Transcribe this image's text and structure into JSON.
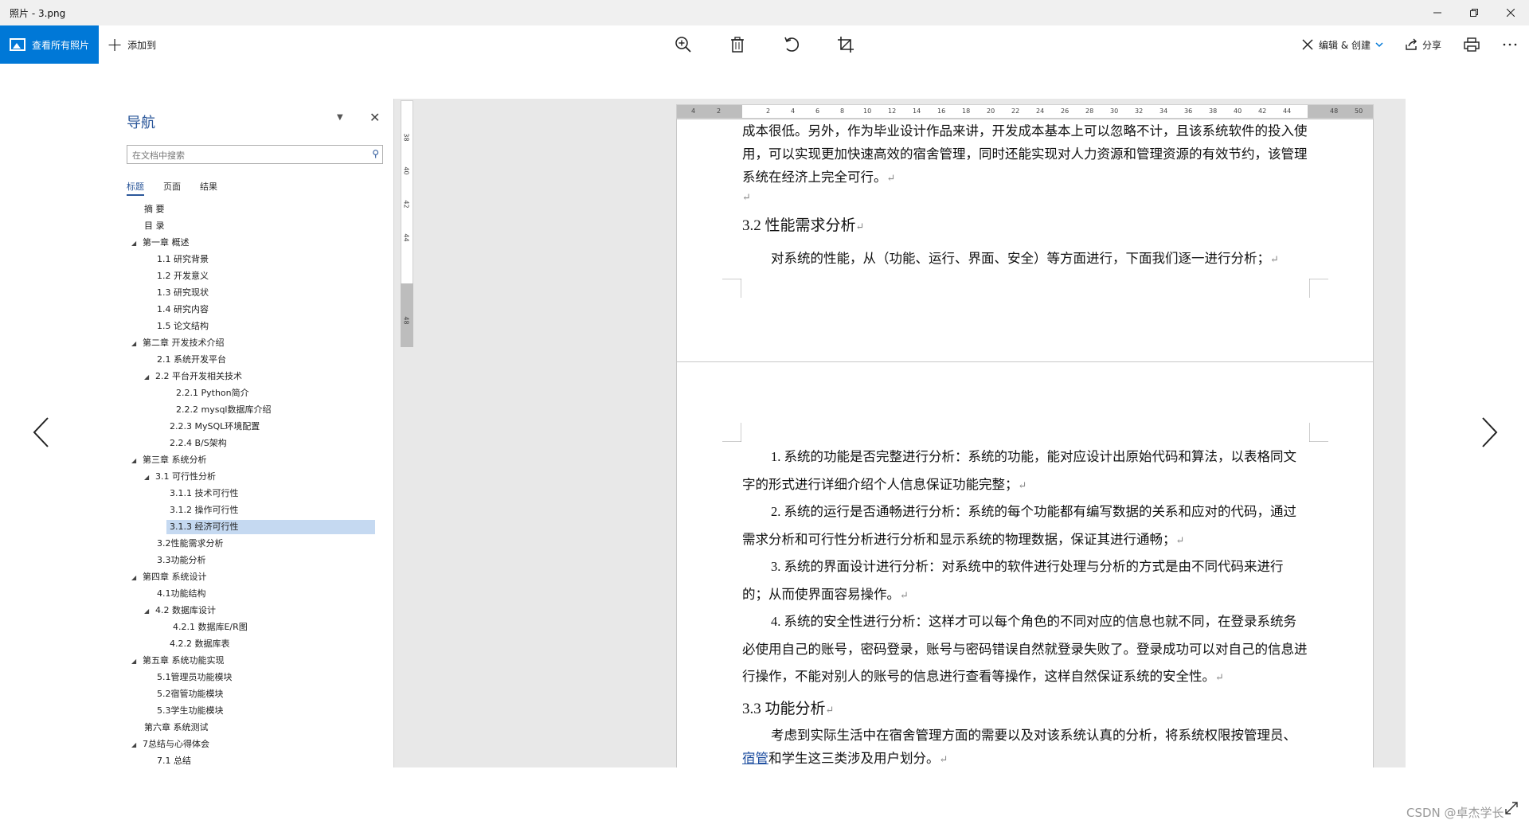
{
  "window": {
    "title": "照片 - 3.png"
  },
  "toolbar": {
    "view_all": "查看所有照片",
    "add_to": "添加到",
    "edit_create": "编辑 & 创建",
    "share": "分享"
  },
  "nav": {
    "title": "导航",
    "search_placeholder": "在文档中搜索",
    "tabs": [
      "标题",
      "页面",
      "结果"
    ],
    "items": [
      "摘  要",
      "目  录",
      "第一章 概述",
      "1.1 研究背景",
      "1.2 开发意义",
      "1.3 研究现状",
      "1.4 研究内容",
      "1.5 论文结构",
      "第二章 开发技术介绍",
      "2.1 系统开发平台",
      "2.2 平台开发相关技术",
      "2.2.1  Python简介",
      "2.2.2  mysql数据库介绍",
      "2.2.3  MySQL环境配置",
      "2.2.4  B/S架构",
      "第三章 系统分析",
      "3.1 可行性分析",
      "3.1.1 技术可行性",
      "3.1.2 操作可行性",
      "3.1.3 经济可行性",
      "3.2性能需求分析",
      "3.3功能分析",
      "第四章 系统设计",
      "4.1功能结构",
      "4.2 数据库设计",
      "4.2.1 数据库E/R图",
      "4.2.2 数据库表",
      "第五章 系统功能实现",
      "5.1管理员功能模块",
      "5.2宿管功能模块",
      "5.3学生功能模块",
      "第六章 系统测试",
      "7总结与心得体会",
      "7.1 总结"
    ]
  },
  "vruler": [
    "38",
    "40",
    "42",
    "44",
    "48"
  ],
  "hruler": [
    "4",
    "2",
    "2",
    "4",
    "6",
    "8",
    "10",
    "12",
    "14",
    "16",
    "18",
    "20",
    "22",
    "24",
    "26",
    "28",
    "30",
    "32",
    "34",
    "36",
    "38",
    "40",
    "42",
    "44",
    "48",
    "50"
  ],
  "page1": {
    "para1": "成本很低。另外，作为毕业设计作品来讲，开发成本基本上可以忽略不计，且该系统软件的投入使用，可以实现更加快速高效的宿舍管理，同时还能实现对人力资源和管理资源的有效节约，该管理系统在经济上完全可行。",
    "heading": "3.2 性能需求分析",
    "para2": "对系统的性能，从（功能、运行、界面、安全）等方面进行，下面我们逐一进行分析；"
  },
  "page2": {
    "item1": "1. 系统的功能是否完整进行分析：系统的功能，能对应设计出原始代码和算法，以表格同文字的形式进行详细介绍个人信息保证功能完整；",
    "item2": "2. 系统的运行是否通畅进行分析：系统的每个功能都有编写数据的关系和应对的代码，通过需求分析和可行性分析进行分析和显示系统的物理数据，保证其进行通畅；",
    "item3": "3. 系统的界面设计进行分析：对系统中的软件进行处理与分析的方式是由不同代码来进行的；从而使界面容易操作。",
    "item4": "4. 系统的安全性进行分析：这样才可以每个角色的不同对应的信息也就不同，在登录系统务必使用自己的账号，密码登录，账号与密码错误自然就登录失败了。登录成功可以对自己的信息进行操作，不能对别人的账号的信息进行查看等操作，这样自然保证系统的安全性。",
    "heading": "3.3 功能分析",
    "para_a": "考虑到实际生活中在宿舍管理方面的需要以及对该系统认真的分析，将系统权限按管理员、",
    "para_link": "宿管",
    "para_b": "和学生这三类涉及用户划分。"
  },
  "watermark": "CSDN @卓杰学长"
}
